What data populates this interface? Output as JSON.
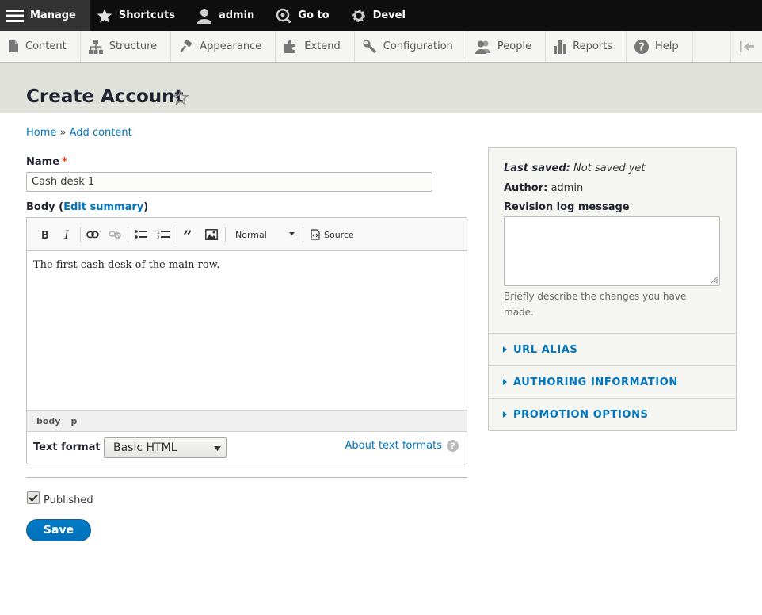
{
  "toolbar": {
    "items": [
      {
        "label": "Manage",
        "icon": "hamburger-icon"
      },
      {
        "label": "Shortcuts",
        "icon": "star-icon"
      },
      {
        "label": "admin",
        "icon": "user-icon"
      },
      {
        "label": "Go to",
        "icon": "search-icon"
      },
      {
        "label": "Devel",
        "icon": "gear-icon"
      }
    ]
  },
  "tray": {
    "items": [
      {
        "label": "Content",
        "icon": "file-icon"
      },
      {
        "label": "Structure",
        "icon": "sitemap-icon"
      },
      {
        "label": "Appearance",
        "icon": "paintbrush-icon"
      },
      {
        "label": "Extend",
        "icon": "puzzle-icon"
      },
      {
        "label": "Configuration",
        "icon": "wrench-icon"
      },
      {
        "label": "People",
        "icon": "people-icon"
      },
      {
        "label": "Reports",
        "icon": "bar-chart-icon"
      },
      {
        "label": "Help",
        "icon": "help-icon"
      }
    ]
  },
  "page": {
    "title": "Create Account"
  },
  "breadcrumb": {
    "home": "Home",
    "separator": "»",
    "add_content": "Add content"
  },
  "form": {
    "name_label": "Name",
    "required_mark": "*",
    "name_value": "Cash desk 1",
    "body_label": "Body",
    "body_paren_open": "(",
    "edit_summary": "Edit summary",
    "body_paren_close": ")",
    "editor": {
      "format_value": "Normal",
      "source_label": "Source",
      "content": "The first cash desk of the main row.",
      "path": [
        "body",
        "p"
      ]
    },
    "text_format_label": "Text format",
    "text_format_value": "Basic HTML",
    "about_text_formats": "About text formats",
    "published_label": "Published",
    "published_checked": true,
    "save_label": "Save"
  },
  "sidebar": {
    "last_saved_label": "Last saved:",
    "last_saved_value": "Not saved yet",
    "author_label": "Author:",
    "author_value": "admin",
    "revision_label": "Revision log message",
    "revision_help": "Briefly describe the changes you have made.",
    "sections": [
      "URL ALIAS",
      "AUTHORING INFORMATION",
      "PROMOTION OPTIONS"
    ]
  },
  "colors": {
    "link": "#0074bd",
    "toolbar_bg": "#0f0f0f",
    "header_bg": "#e1e1dc",
    "save_bg": "#0071b8",
    "required": "#e32700"
  }
}
